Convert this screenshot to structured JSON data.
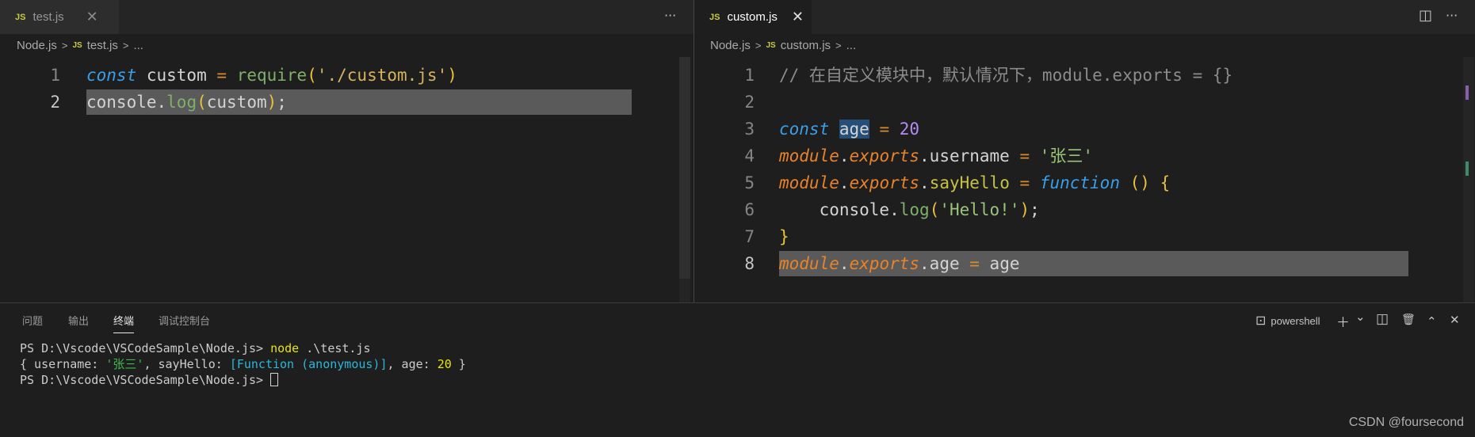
{
  "left_editor": {
    "tab": {
      "badge": "JS",
      "label": "test.js",
      "close": "✕"
    },
    "more": "···",
    "breadcrumb": {
      "folder": "Node.js",
      "sep": ">",
      "badge": "JS",
      "file": "test.js",
      "more": "..."
    },
    "lines": [
      {
        "num": "1",
        "parts": [
          {
            "c": "kw",
            "t": "const"
          },
          {
            "c": "var",
            "t": " custom "
          },
          {
            "c": "op",
            "t": "="
          },
          {
            "c": "var",
            "t": " "
          },
          {
            "c": "fn2",
            "t": "require"
          },
          {
            "c": "paren",
            "t": "("
          },
          {
            "c": "str2",
            "t": "'./custom.js'"
          },
          {
            "c": "paren",
            "t": ")"
          }
        ]
      },
      {
        "num": "2",
        "current": true,
        "parts": [
          {
            "c": "var",
            "t": "console."
          },
          {
            "c": "fn2",
            "t": "log"
          },
          {
            "c": "paren",
            "t": "("
          },
          {
            "c": "var",
            "t": "custom"
          },
          {
            "c": "paren",
            "t": ")"
          },
          {
            "c": "var",
            "t": ";"
          }
        ]
      }
    ]
  },
  "right_editor": {
    "tab": {
      "badge": "JS",
      "label": "custom.js",
      "close": "✕"
    },
    "more": "···",
    "breadcrumb": {
      "folder": "Node.js",
      "sep": ">",
      "badge": "JS",
      "file": "custom.js",
      "more": "..."
    },
    "lines": [
      {
        "num": "1",
        "parts": [
          {
            "c": "cmt",
            "t": "// 在自定义模块中，默认情况下，module.exports = {}"
          }
        ]
      },
      {
        "num": "2",
        "parts": []
      },
      {
        "num": "3",
        "parts": [
          {
            "c": "kw",
            "t": "const"
          },
          {
            "c": "var",
            "t": " "
          },
          {
            "c": "var sel",
            "t": "age"
          },
          {
            "c": "var",
            "t": " "
          },
          {
            "c": "op",
            "t": "="
          },
          {
            "c": "var",
            "t": " "
          },
          {
            "c": "num",
            "t": "20"
          }
        ]
      },
      {
        "num": "4",
        "parts": [
          {
            "c": "mod",
            "t": "module"
          },
          {
            "c": "var",
            "t": "."
          },
          {
            "c": "mod",
            "t": "exports"
          },
          {
            "c": "var",
            "t": ".username "
          },
          {
            "c": "op",
            "t": "="
          },
          {
            "c": "var",
            "t": " "
          },
          {
            "c": "str",
            "t": "'张三'"
          }
        ]
      },
      {
        "num": "5",
        "parts": [
          {
            "c": "mod",
            "t": "module"
          },
          {
            "c": "var",
            "t": "."
          },
          {
            "c": "mod",
            "t": "exports"
          },
          {
            "c": "var",
            "t": "."
          },
          {
            "c": "fn",
            "t": "sayHello"
          },
          {
            "c": "var",
            "t": " "
          },
          {
            "c": "op",
            "t": "="
          },
          {
            "c": "var",
            "t": " "
          },
          {
            "c": "kw",
            "t": "function"
          },
          {
            "c": "var",
            "t": " "
          },
          {
            "c": "paren",
            "t": "()"
          },
          {
            "c": "var",
            "t": " "
          },
          {
            "c": "paren",
            "t": "{"
          }
        ]
      },
      {
        "num": "6",
        "parts": [
          {
            "c": "var",
            "t": "    console."
          },
          {
            "c": "fn2",
            "t": "log"
          },
          {
            "c": "paren",
            "t": "("
          },
          {
            "c": "str",
            "t": "'Hello!'"
          },
          {
            "c": "paren",
            "t": ")"
          },
          {
            "c": "var",
            "t": ";"
          }
        ]
      },
      {
        "num": "7",
        "parts": [
          {
            "c": "paren",
            "t": "}"
          }
        ]
      },
      {
        "num": "8",
        "current": true,
        "parts": [
          {
            "c": "mod",
            "t": "module"
          },
          {
            "c": "var",
            "t": "."
          },
          {
            "c": "mod",
            "t": "exports"
          },
          {
            "c": "var",
            "t": ".age "
          },
          {
            "c": "op",
            "t": "="
          },
          {
            "c": "var",
            "t": " age"
          }
        ]
      }
    ],
    "actions": {
      "split": "◫",
      "more": "···"
    }
  },
  "panel": {
    "tabs": [
      "问题",
      "输出",
      "终端",
      "调试控制台"
    ],
    "active_tab": "终端",
    "shell": {
      "icon": "⊡",
      "label": "powershell"
    },
    "tools": {
      "add": "＋",
      "dropdown": "⌄",
      "split": "◫",
      "trash": "🗑",
      "maximize": "⌃",
      "close": "✕"
    },
    "terminal": [
      [
        {
          "c": "",
          "t": "PS D:\\Vscode\\VSCodeSample\\Node.js> "
        },
        {
          "c": "t-yellow",
          "t": "node"
        },
        {
          "c": "",
          "t": " .\\test.js"
        }
      ],
      [
        {
          "c": "",
          "t": "{ username: "
        },
        {
          "c": "t-green",
          "t": "'张三'"
        },
        {
          "c": "",
          "t": ", sayHello: "
        },
        {
          "c": "t-cyan",
          "t": "[Function (anonymous)]"
        },
        {
          "c": "",
          "t": ", age: "
        },
        {
          "c": "t-num",
          "t": "20"
        },
        {
          "c": "",
          "t": " }"
        }
      ],
      [
        {
          "c": "",
          "t": "PS D:\\Vscode\\VSCodeSample\\Node.js> "
        }
      ]
    ]
  },
  "watermark": "CSDN @foursecond",
  "colors": {
    "editor_bg": "#1e1e1e",
    "tabbar_bg": "#252526",
    "js_badge": "#cbcb41",
    "line_highlight": "#5a5a5a"
  }
}
